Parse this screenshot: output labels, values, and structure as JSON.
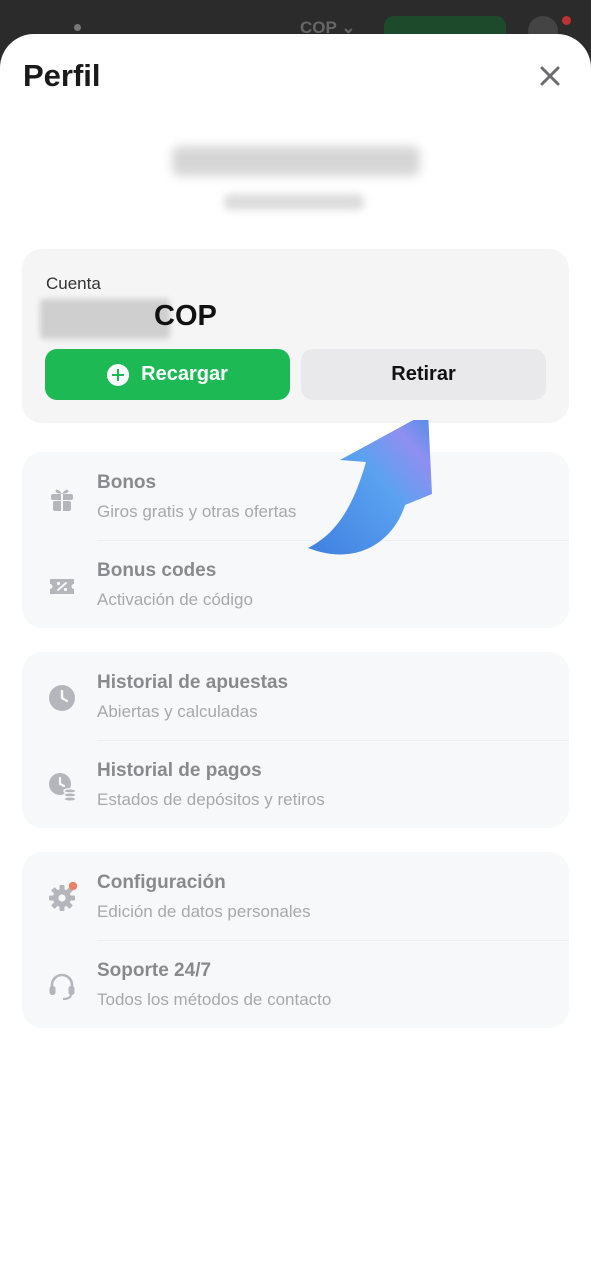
{
  "background": {
    "currency": "COP ⌄"
  },
  "sheet": {
    "title": "Perfil"
  },
  "account": {
    "label": "Cuenta",
    "currency": "COP",
    "deposit_label": "Recargar",
    "withdraw_label": "Retirar"
  },
  "groups": [
    {
      "items": [
        {
          "title": "Bonos",
          "subtitle": "Giros gratis y otras ofertas",
          "icon": "gift-icon"
        },
        {
          "title": "Bonus codes",
          "subtitle": "Activación de código",
          "icon": "ticket-icon"
        }
      ]
    },
    {
      "items": [
        {
          "title": "Historial de apuestas",
          "subtitle": "Abiertas y calculadas",
          "icon": "clock-icon"
        },
        {
          "title": "Historial de pagos",
          "subtitle": "Estados de depósitos y retiros",
          "icon": "payment-history-icon"
        }
      ]
    },
    {
      "items": [
        {
          "title": "Configuración",
          "subtitle": "Edición de datos personales",
          "icon": "gear-icon"
        },
        {
          "title": "Soporte 24/7",
          "subtitle": "Todos los métodos de contacto",
          "icon": "headset-icon"
        }
      ]
    }
  ],
  "colors": {
    "accent_green": "#1db954",
    "notification_dot": "#e8826b",
    "arrow_blue": "#4a8fe6"
  }
}
